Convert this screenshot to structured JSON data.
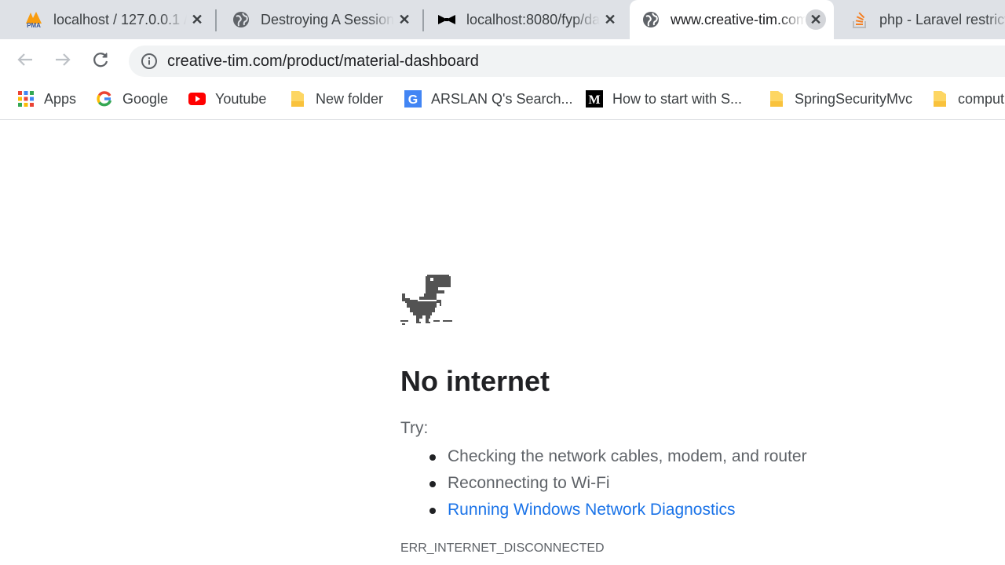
{
  "tabs": [
    {
      "title": "localhost / 127.0.0.1 / ",
      "icon": "phpmyadmin-icon",
      "active": false
    },
    {
      "title": "Destroying A Session",
      "icon": "globe-icon",
      "active": false
    },
    {
      "title": "localhost:8080/fyp/da",
      "icon": "bowtie-icon",
      "active": false
    },
    {
      "title": "www.creative-tim.com",
      "icon": "globe-icon",
      "active": true
    },
    {
      "title": "php - Laravel restrict",
      "icon": "stackoverflow-icon",
      "active": false
    }
  ],
  "toolbar": {
    "url": "creative-tim.com/product/material-dashboard"
  },
  "bookmarks": [
    {
      "label": "Apps",
      "icon": "apps-grid-icon"
    },
    {
      "label": "Google",
      "icon": "google-icon"
    },
    {
      "label": "Youtube",
      "icon": "youtube-icon"
    },
    {
      "label": "New folder",
      "icon": "folder-icon"
    },
    {
      "label": "ARSLAN Q's Search...",
      "icon": "g-blue-icon"
    },
    {
      "label": "How to start with S...",
      "icon": "medium-icon"
    },
    {
      "label": "SpringSecurityMvc",
      "icon": "folder-icon"
    },
    {
      "label": "comput",
      "icon": "folder-icon"
    }
  ],
  "error_page": {
    "heading": "No internet",
    "try_label": "Try:",
    "suggestions": [
      "Checking the network cables, modem, and router",
      "Reconnecting to Wi-Fi",
      "Running Windows Network Diagnostics"
    ],
    "error_code": "ERR_INTERNET_DISCONNECTED"
  },
  "colors": {
    "tabstrip_bg": "#dee1e6",
    "omnibox_bg": "#f1f3f4",
    "link_blue": "#1a73e8",
    "folder_yellow": "#fdd663",
    "youtube_red": "#ff0000"
  }
}
